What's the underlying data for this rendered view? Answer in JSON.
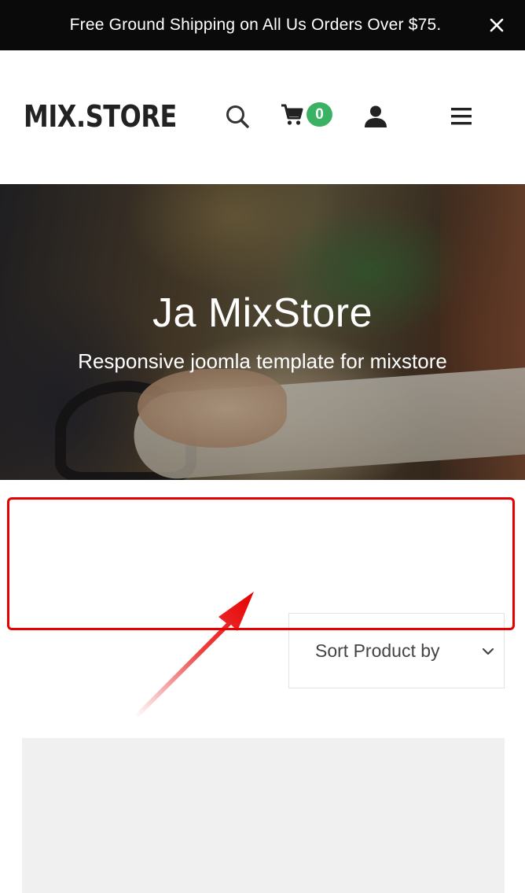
{
  "announcement": {
    "text": "Free Ground Shipping on All Us Orders Over $75.",
    "close_icon": "close-icon"
  },
  "header": {
    "logo": "MIX.STORE",
    "icons": [
      "search-icon",
      "cart-icon",
      "user-icon",
      "hamburger-menu-icon"
    ],
    "cart_count": "0",
    "badge_color": "#3bb263"
  },
  "hero": {
    "title": "Ja MixStore",
    "subtitle": "Responsive joomla template for mixstore"
  },
  "annotation": {
    "color": "#e60000"
  },
  "sort": {
    "selected": "Sort Product by",
    "icon": "chevron-down-icon"
  }
}
